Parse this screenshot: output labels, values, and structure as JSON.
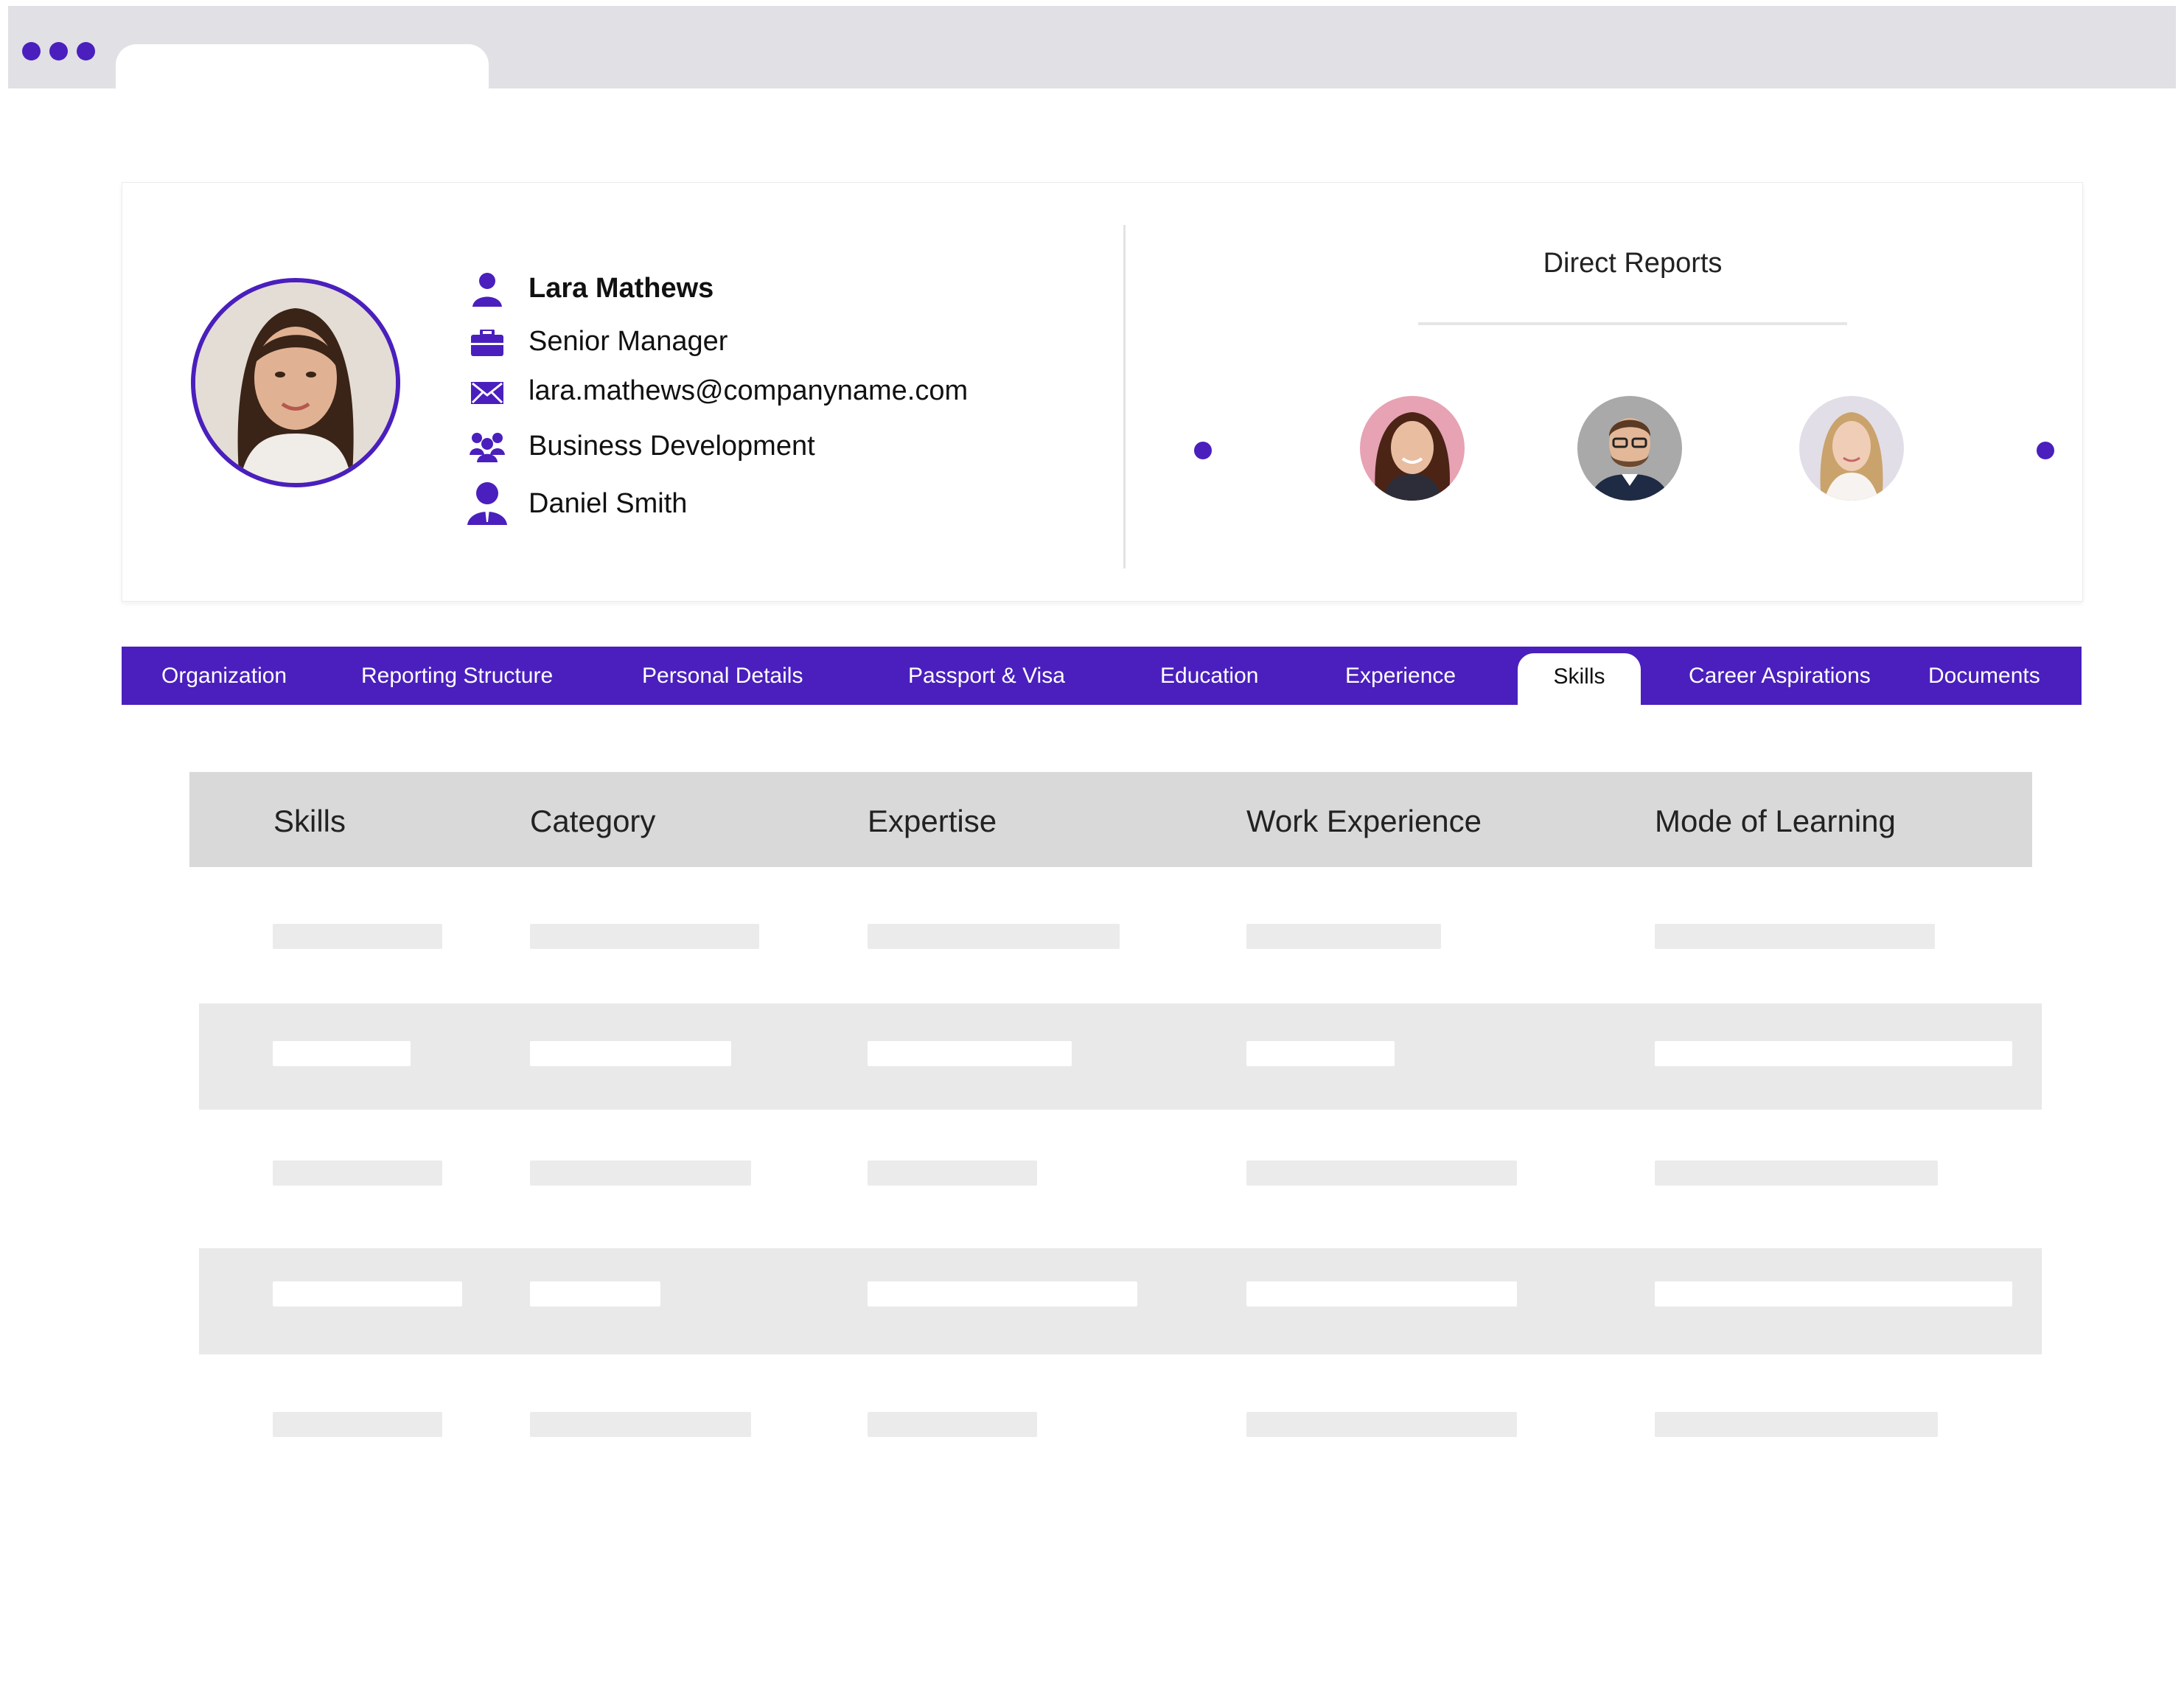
{
  "window": {
    "accent_color": "#4a1fbd"
  },
  "profile": {
    "name": "Lara Mathews",
    "title": "Senior Manager",
    "email": "lara.mathews@companyname.com",
    "department": "Business Development",
    "manager": "Daniel Smith",
    "icons": [
      "user-icon",
      "briefcase-icon",
      "envelope-icon",
      "team-icon",
      "manager-icon"
    ]
  },
  "direct_reports": {
    "title": "Direct Reports"
  },
  "tabs": [
    {
      "label": "Organization"
    },
    {
      "label": "Reporting Structure"
    },
    {
      "label": "Personal Details"
    },
    {
      "label": "Passport & Visa"
    },
    {
      "label": "Education"
    },
    {
      "label": "Experience"
    },
    {
      "label": "Skills",
      "active": true
    },
    {
      "label": "Career Aspirations"
    },
    {
      "label": "Documents"
    }
  ],
  "table": {
    "columns": [
      "Skills",
      "Category",
      "Expertise",
      "Work Experience",
      "Mode of Learning"
    ]
  }
}
